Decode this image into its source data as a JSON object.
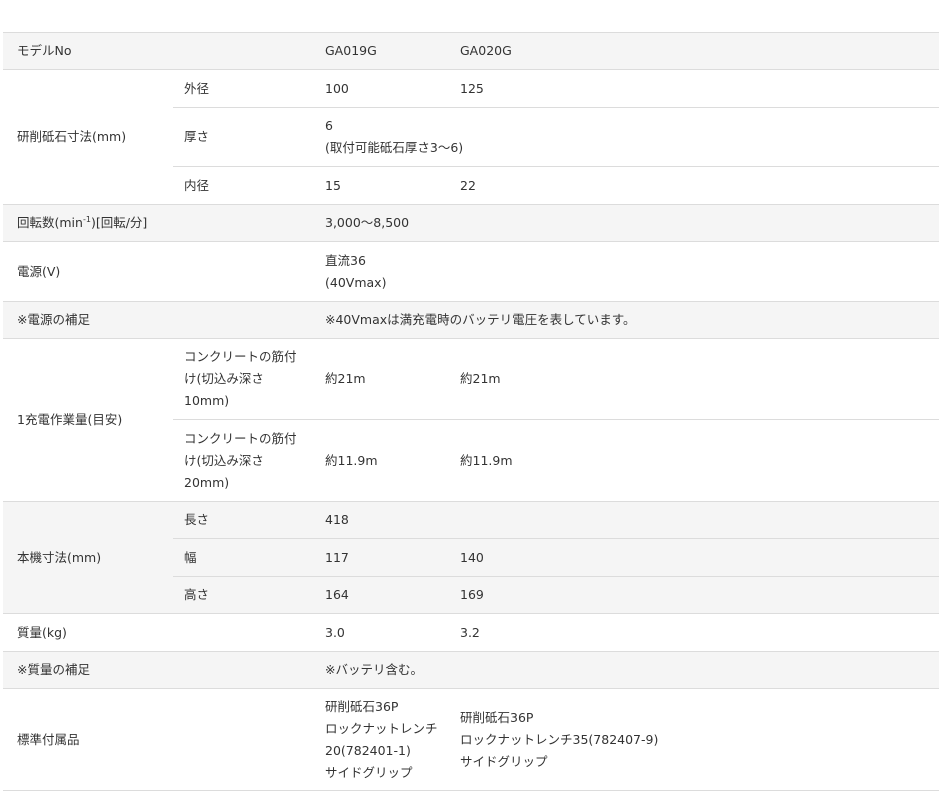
{
  "header": {
    "label": "モデルNo",
    "model1": "GA019G",
    "model2": "GA020G"
  },
  "wheel": {
    "label": "研削砥石寸法(mm)",
    "outer": {
      "label": "外径",
      "v1": "100",
      "v2": "125"
    },
    "thickness": {
      "label": "厚さ",
      "v_line1": "6",
      "v_line2": "(取付可能砥石厚さ3〜6)"
    },
    "inner": {
      "label": "内径",
      "v1": "15",
      "v2": "22"
    }
  },
  "rpm": {
    "label_pre": "回転数(min",
    "label_sup": "-1",
    "label_post": ")[回転/分]",
    "value": "3,000〜8,500"
  },
  "power": {
    "label": "電源(V)",
    "v_line1": "直流36",
    "v_line2": "(40Vmax)"
  },
  "power_note": {
    "label": "※電源の補足",
    "value": "※40Vmaxは満充電時のバッテリ電圧を表しています。"
  },
  "work": {
    "label": "1充電作業量(目安)",
    "row1": {
      "sub_line1": "コンクリートの筋付",
      "sub_line2": "け(切込み深さ",
      "sub_line3": "10mm)",
      "v1": "約21m",
      "v2": "約21m"
    },
    "row2": {
      "sub_line1": "コンクリートの筋付",
      "sub_line2": "け(切込み深さ",
      "sub_line3": "20mm)",
      "v1": "約11.9m",
      "v2": "約11.9m"
    }
  },
  "body_dims": {
    "label": "本機寸法(mm)",
    "length": {
      "label": "長さ",
      "value": "418"
    },
    "width": {
      "label": "幅",
      "v1": "117",
      "v2": "140"
    },
    "height": {
      "label": "高さ",
      "v1": "164",
      "v2": "169"
    }
  },
  "mass": {
    "label": "質量(kg)",
    "v1": "3.0",
    "v2": "3.2"
  },
  "mass_note": {
    "label": "※質量の補足",
    "value": "※バッテリ含む。"
  },
  "accessories": {
    "label": "標準付属品",
    "v1_lines": [
      "研削砥石36P",
      "ロックナットレンチ",
      "20(782401-1)",
      "サイドグリップ"
    ],
    "v2_lines": [
      "研削砥石36P",
      "ロックナットレンチ35(782407-9)",
      "サイドグリップ"
    ]
  }
}
